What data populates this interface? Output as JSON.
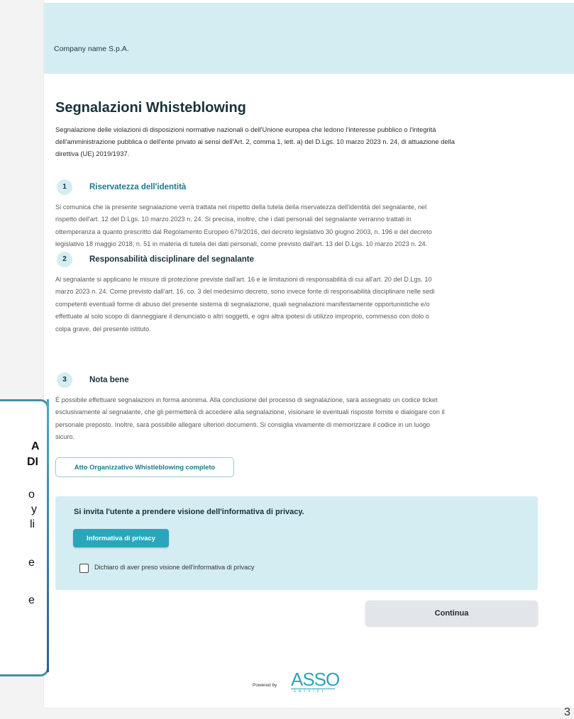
{
  "header": {
    "company": "Company name S.p.A."
  },
  "main": {
    "title": "Segnalazioni Whisteblowing",
    "intro_lines": [
      "Segnalazione delle violazioni di disposizioni normative nazionali o dell'Unione europea che ledono l'interesse pubblico o l'integrità",
      "dell'amministrazione pubblica o dell'ente privato ai sensi dell'Art. 2, comma 1, lett. a) del D.Lgs. 10 marzo 2023 n. 24, di attuazione della",
      "direttiva (UE) 2019/1937."
    ],
    "sections": [
      {
        "number": "1",
        "title": "Riservatezza dell'identità",
        "lines": [
          "Si comunica che la presente segnalazione verrà trattata nel rispetto della tutela della riservatezza dell'identità del segnalante, nel",
          "rispetto dell'art. 12 del D.Lgs. 10 marzo 2023 n. 24. Si precisa, inoltre, che i dati personali del segnalante verranno trattati in",
          "ottemperanza a quanto prescritto dal Regolamento Europeo 679/2016, del decreto legislativo 30 giugno 2003, n. 196 e del decreto",
          "legislativo 18 maggio 2018, n. 51 in materia di tutela dei dati personali, come previsto dall'art. 13 del D.Lgs. 10 marzo 2023 n. 24."
        ]
      },
      {
        "number": "2",
        "title": "Responsabilità disciplinare del segnalante",
        "lines": [
          "Al segnalante si applicano le misure di protezione previste dall'art. 16 e le limitazioni di responsabilità di cui all'art. 20 del D.Lgs. 10",
          "marzo 2023 n. 24. Come previsto dall'art. 16, co. 3 del medesimo decreto, sono invece fonte di responsabilità disciplinare nelle sedi",
          "competenti eventuali forme di abuso del presente sistema di segnalazione, quali segnalazioni manifestamente opportunistiche e/o",
          "effettuate al solo scopo di danneggiare il denunciato o altri soggetti, e ogni altra ipotesi di utilizzo improprio, commesso con dolo o",
          "colpa grave, del presente istituto."
        ]
      },
      {
        "number": "3",
        "title": "Nota bene",
        "lines": [
          "È possibile effettuare segnalazioni in forma anonima. Alla conclusione del processo di segnalazione, sarà assegnato un codice ticket",
          "esclusivamente al segnalante, che gli permetterà di accedere alla segnalazione, visionare le eventuali risposte fornite e dialogare con il",
          "personale preposto. Inoltre, sarà possibile allegare ulteriori documenti. Si consiglia vivamente di memorizzare il codice in un luogo",
          "sicuro."
        ]
      }
    ],
    "atto_button": "Atto Organizzativo Whistleblowing completo",
    "privacy": {
      "text": "Si invita l'utente a prendere visione dell'informativa di privacy.",
      "button": "Informativa di privacy",
      "checkbox_label": "Dichiaro di aver preso visione dell'informativa di privacy"
    },
    "continue_button": "Continua"
  },
  "footer": {
    "powered_by": "Powered by",
    "logo_text": "ASSO",
    "logo_sub": "servizi"
  },
  "left_panel": {
    "fragments": [
      "A",
      "DI",
      "o",
      "y",
      "li",
      "e",
      "e"
    ]
  },
  "page_number": "3"
}
